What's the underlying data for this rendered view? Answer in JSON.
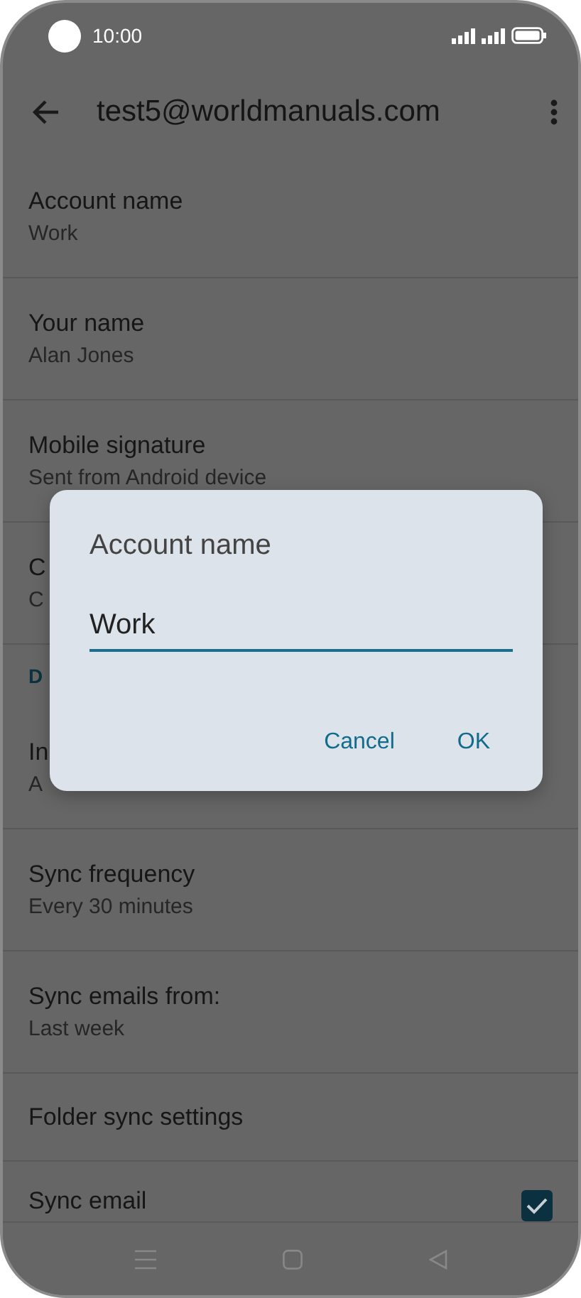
{
  "status_bar": {
    "time": "10:00"
  },
  "app_bar": {
    "title": "test5@worldmanuals.com"
  },
  "settings": [
    {
      "kind": "item",
      "title": "Account name",
      "subtitle": "Work"
    },
    {
      "kind": "item",
      "title": "Your name",
      "subtitle": "Alan Jones"
    },
    {
      "kind": "item",
      "title": "Mobile signature",
      "subtitle": "Sent from Android device"
    },
    {
      "kind": "item",
      "title": "C",
      "subtitle": "C"
    },
    {
      "kind": "header",
      "title": "D"
    },
    {
      "kind": "item",
      "title": "In",
      "subtitle": "A"
    },
    {
      "kind": "item",
      "title": "Sync frequency",
      "subtitle": "Every 30 minutes"
    },
    {
      "kind": "item",
      "title": "Sync emails from:",
      "subtitle": "Last week"
    },
    {
      "kind": "item",
      "title": "Folder sync settings"
    },
    {
      "kind": "checkbox",
      "title": "Sync email",
      "checked": true
    }
  ],
  "dialog": {
    "title": "Account name",
    "value": "Work",
    "buttons": [
      "Cancel",
      "OK"
    ]
  }
}
